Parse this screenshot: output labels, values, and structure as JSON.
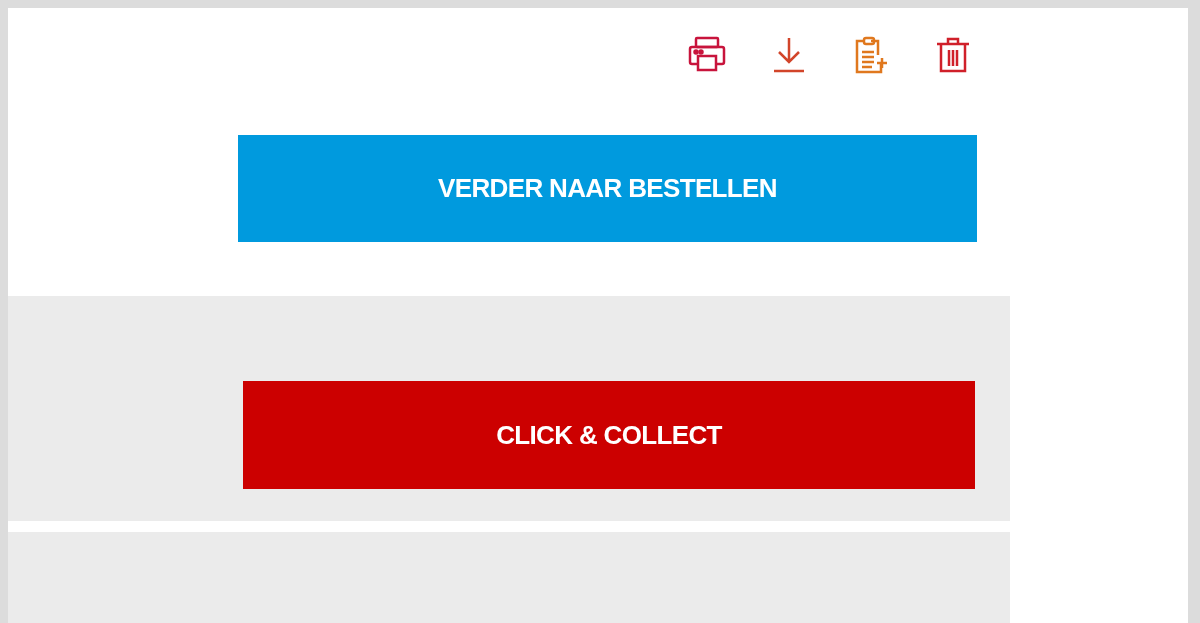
{
  "toolbar": [
    {
      "kind": "print"
    },
    {
      "kind": "download"
    },
    {
      "kind": "clipboard"
    },
    {
      "kind": "trash"
    }
  ],
  "checkout_button": {
    "label": "VERDER NAAR BESTELLEN"
  },
  "collect_button": {
    "label": "CLICK & COLLECT"
  }
}
